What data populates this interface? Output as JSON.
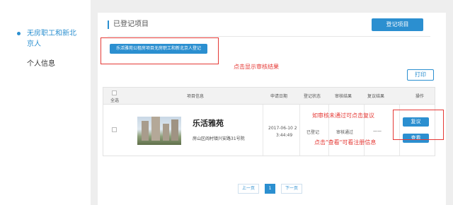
{
  "sidebar": {
    "items": [
      {
        "label": "无房职工和新北京人"
      },
      {
        "label": "个人信息"
      }
    ]
  },
  "main": {
    "section_title": "已登记项目",
    "register_button": "登记项目",
    "project_button": "乐活雅苑公租房项目无房职工和新北京人登记",
    "print_button": "打印"
  },
  "table": {
    "headers": {
      "select_all": "全选",
      "project_info": "项目信息",
      "apply_date": "申请日期",
      "register_status": "登记状态",
      "review_result": "审核结果",
      "recheck_result": "复议结果",
      "action": "操作"
    },
    "row": {
      "name": "乐活雅苑",
      "address": "房山区阎村镇兴安路31号院",
      "date": "2017-06-10 2",
      "time": "3:44:49",
      "register_status": "已登记",
      "review_result": "审核通过",
      "recheck_result": "——",
      "btn_review": "复议",
      "btn_view": "查看"
    }
  },
  "pagination": {
    "prev": "上一页",
    "current": "1",
    "next": "下一页"
  },
  "annotations": {
    "click_result": "点击显示审核结果",
    "review_hint": "如审核未通过可点击复议",
    "view_hint": "点击\"查看\"可看注册信息"
  },
  "colors": {
    "accent": "#2b8fd0",
    "annotation": "#e53935"
  }
}
